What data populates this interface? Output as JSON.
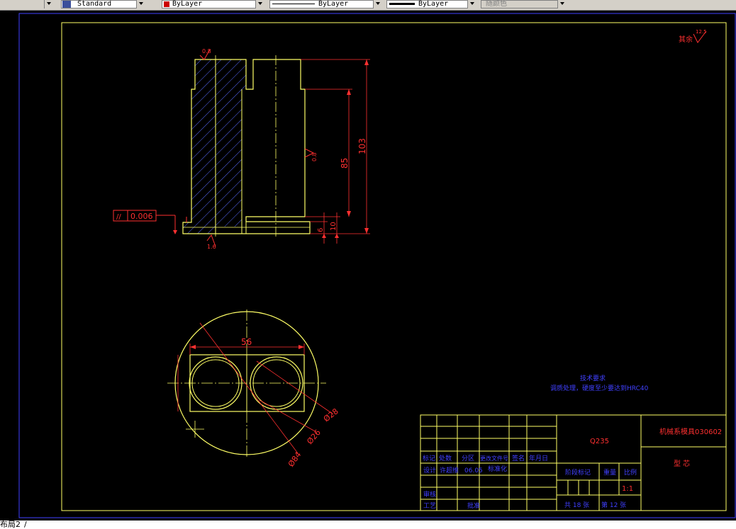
{
  "toolbar": {
    "text_style": "Standard",
    "color_control": "ByLayer",
    "linetype_control": "ByLayer",
    "lineweight_control": "ByLayer",
    "plot_style": "随颜色"
  },
  "drawing": {
    "dims_front": {
      "parallelism": "0.006",
      "parallelism_symbol": "//",
      "roughness_top": "0.8",
      "roughness_right": "0.8",
      "roughness_bottom": "1.6",
      "height_85": "85",
      "height_103": "103",
      "dim_6": "6",
      "dim_10": "10"
    },
    "dims_top": {
      "width_56": "56",
      "dia_28": "Ø28",
      "dia_26": "Ø26",
      "dia_84": "Ø84"
    },
    "surface_note": {
      "label": "其余",
      "value": "12.5"
    },
    "tech_req": {
      "title": "技术要求",
      "text": "调质处理，硬度至少要达到HRC40"
    },
    "title_block": {
      "headers": [
        "标记",
        "处数",
        "分区",
        "更改文件号",
        "签名",
        "年月日"
      ],
      "design_label": "设计",
      "designer": "许超维",
      "design_date": "06.05",
      "standardize_label": "标准化",
      "review_label": "审核",
      "process_label": "工艺",
      "approve_label": "批准",
      "material": "Q235",
      "company": "机械系模具030602",
      "part_name": "型 芯",
      "stage_label": "阶段标记",
      "weight_label": "重量",
      "scale_label": "比例",
      "scale": "1:1",
      "total_sheets": "共 18 张",
      "sheet_no": "第 12 张"
    }
  },
  "statusbar": {
    "layout_tab": "布局2"
  }
}
